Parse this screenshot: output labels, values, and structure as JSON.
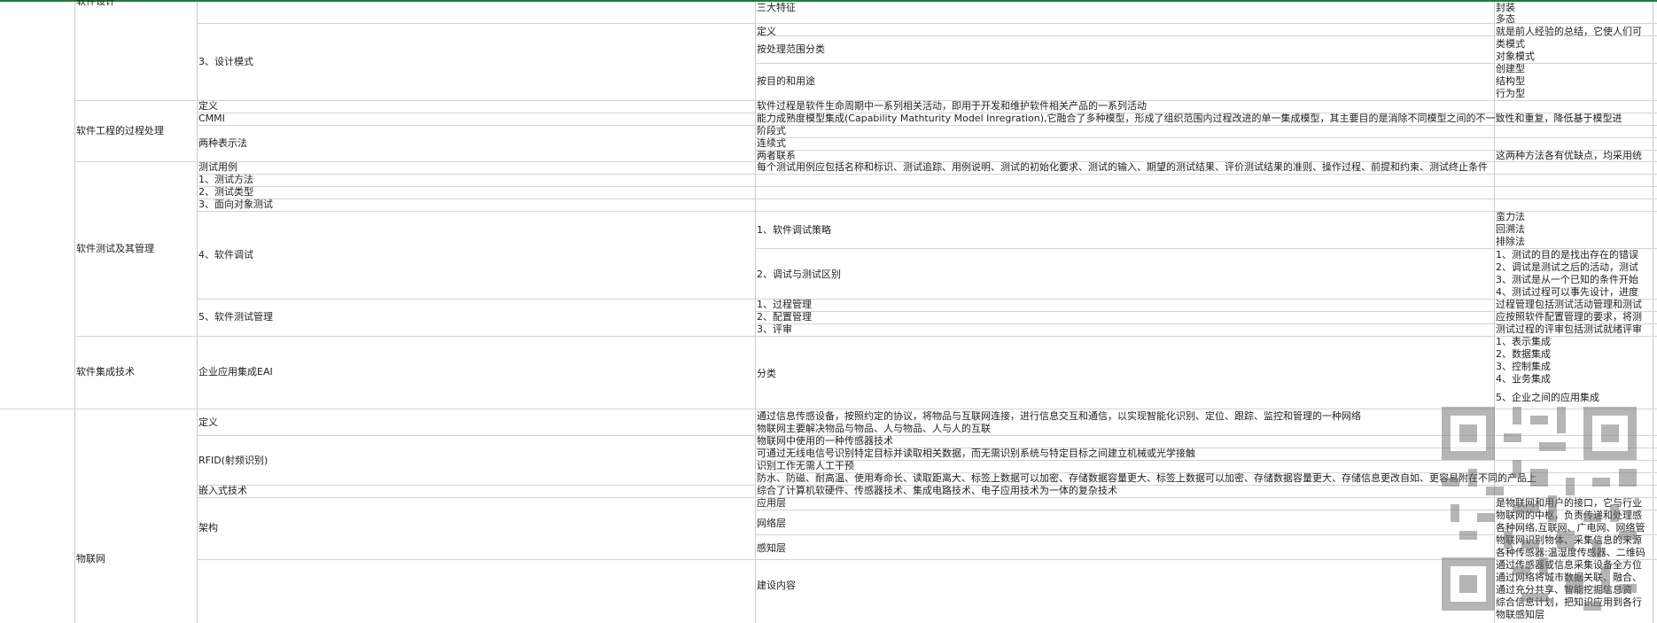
{
  "sections": {
    "design": "软件设计",
    "process": "软件工程的过程处理",
    "testing": "软件测试及其管理",
    "integration": "软件集成技术",
    "iot": "物联网"
  },
  "col2": {
    "design_patterns": "3、设计模式",
    "proc_def": "定义",
    "cmmi": "CMMI",
    "two_repr": "两种表示法",
    "test_case": "测试用例",
    "test_method": "1、测试方法",
    "test_type": "2、测试类型",
    "oo_test": "3、面向对象测试",
    "debug": "4、软件调试",
    "test_mgmt": "5、软件测试管理",
    "eai": "企业应用集成EAI",
    "iot_def": "定义",
    "rfid": "RFID(射频识别)",
    "embedded": "嵌入式技术",
    "arch": "架构"
  },
  "col3": {
    "three_features": "三大特征",
    "dp_def": "定义",
    "by_scope": "按处理范围分类",
    "by_purpose": "按目的和用途",
    "proc_def_text": "软件过程是软件生命周期中一系列相关活动，即用于开发和维护软件相关产品的一系列活动",
    "cmmi_text": "能力成熟度模型集成(Capability Mathturity Model Inregration),它融合了多种模型，形成了组织范围内过程改进的单一集成模型，其主要目的是消除不同模型之间的不一致性和重复，降低基于模型进",
    "staged": "阶段式",
    "continuous": "连续式",
    "both_link": "两者联系",
    "test_case_text": "每个测试用例应包括名称和标识、测试追踪、用例说明、测试的初始化要求、测试的输入、期望的测试结果、评价测试结果的准则、操作过程、前提和约束、测试终止条件",
    "debug_strategy": "1、软件调试策略",
    "debug_vs_test": "2、调试与测试区别",
    "proc_mgmt": "1、过程管理",
    "config_mgmt": "2、配置管理",
    "review": "3、评审",
    "classify": "分类",
    "iot_def_text": "通过信息传感设备，按照约定的协议，将物品与互联网连接，进行信息交互和通信，以实现智能化识别、定位、跟踪、监控和管理的一种网络",
    "iot_main": "物联网主要解决物品与物品、人与物品、人与人的互联",
    "rfid_1": "物联网中使用的一种传感器技术",
    "rfid_2": "可通过无线电信号识别特定目标并读取相关数据，而无需识别系统与特定目标之间建立机械或光学接触",
    "rfid_3": "识别工作无需人工干预",
    "rfid_4": "防水、防磁、耐高温、使用寿命长、读取距离大、标签上数据可以加密、存储数据容量更大、标签上数据可以加密、存储数据容量更大、存储信息更改自如、更容易附在不同的产品上",
    "embedded_text": "综合了计算机软硬件、传感器技术、集成电路技术、电子应用技术为一体的复杂技术",
    "app_layer": "应用层",
    "net_layer": "网络层",
    "perception_layer": "感知层",
    "construction": "建设内容"
  },
  "col4": {
    "encap": "封装",
    "poly": "多态",
    "dp_def_text": "就是前人经验的总结，它使人们可",
    "class_mode": "类模式",
    "object_mode": "对象模式",
    "creational": "创建型",
    "structural": "结构型",
    "behavioral": "行为型",
    "both_text": "这两种方法各有优缺点，均采用统",
    "brute": "蛮力法",
    "backtrack": "回溯法",
    "elimination": "排除法",
    "dt1": "1、测试的目的是找出存在的错误",
    "dt2": "2、调试是测试之后的活动，测试",
    "dt3": "3、测试是从一个已知的条件开始",
    "dt4": "4、测试过程可以事先设计，进度",
    "pm_text": "过程管理包括测试活动管理和测试",
    "cm_text": "应按照软件配置管理的要求，将测",
    "rv_text": "测试过程的评审包括测试就绪评审",
    "eai1": "1、表示集成",
    "eai2": "2、数据集成",
    "eai3": "3、控制集成",
    "eai4": "4、业务集成",
    "eai5": "5、企业之间的应用集成",
    "app_text": "是物联网和用户的接口，它与行业",
    "net_text": "物联网的中枢，负责传递和处理感",
    "net_text2": "各种网络,互联网、广电网、网络管",
    "per_text": "物联网识别物体、采集信息的来源",
    "per_text2": "各种传感器:温湿度传感器、二维码",
    "b1": "通过传感器或信息采集设备全方位",
    "b2": "通过网络将城市数据关联、融合、",
    "b3": "通过充分共享、智能挖掘信息资",
    "b4": "综合信息计划，把知识应用到各行",
    "b5": "物联感知层"
  }
}
